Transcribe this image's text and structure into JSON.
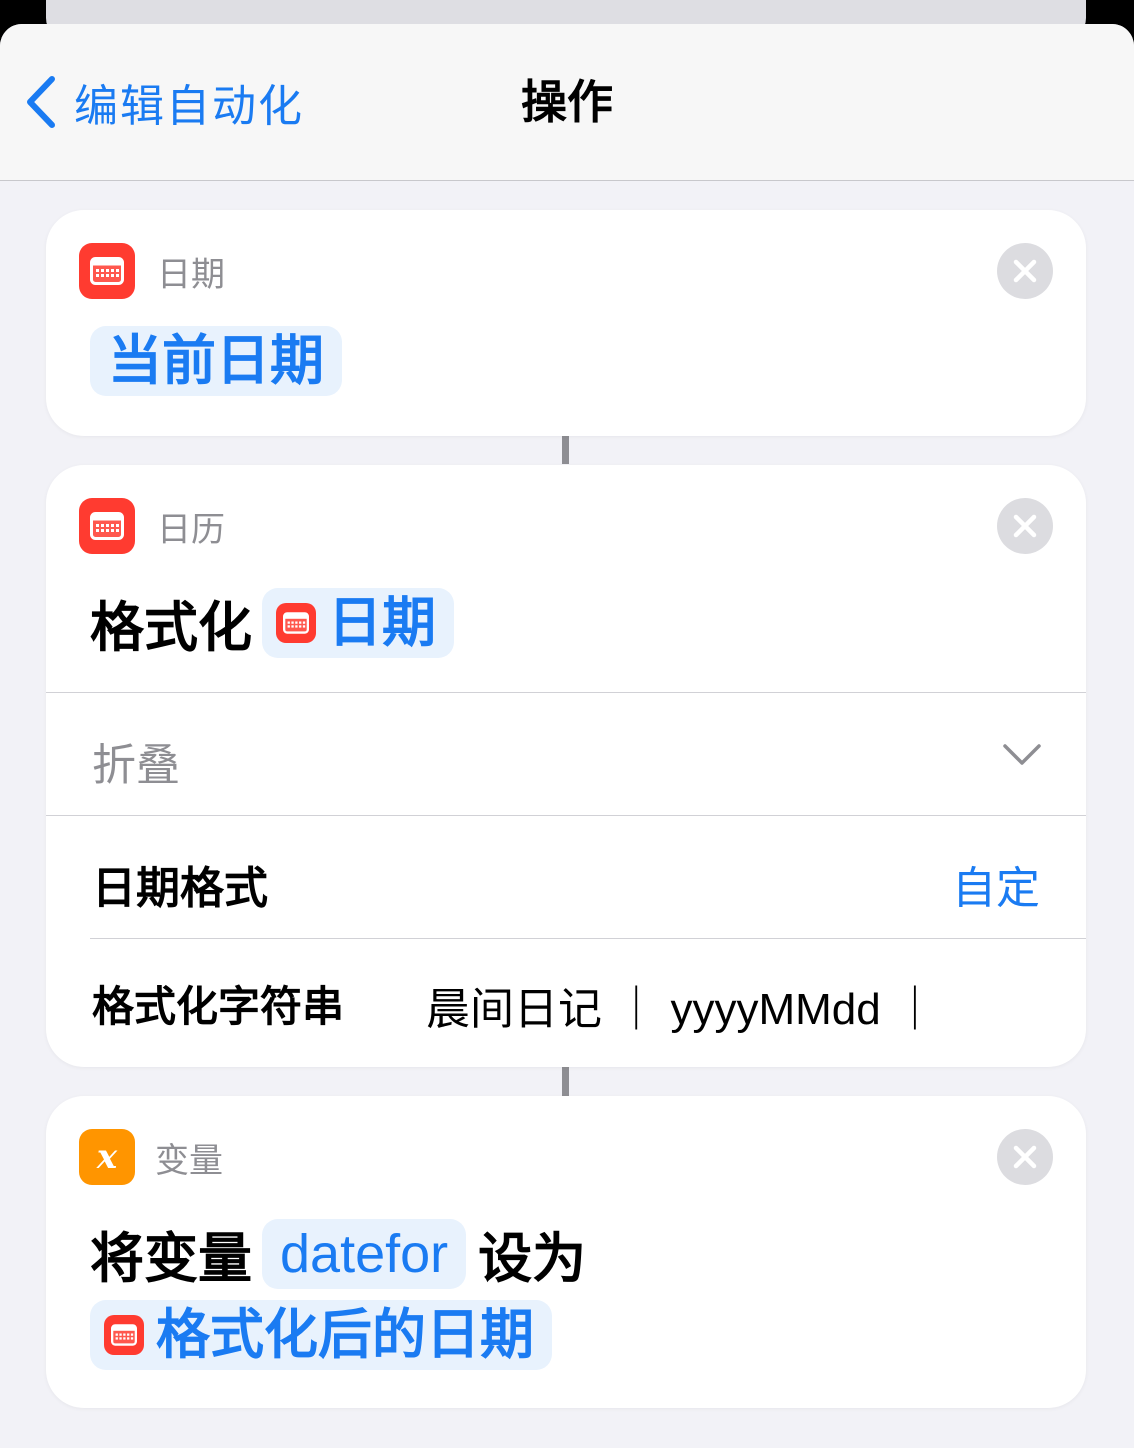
{
  "navbar": {
    "back_label": "编辑自动化",
    "title": "操作"
  },
  "cards": [
    {
      "app_label": "日期",
      "action_token": "当前日期"
    },
    {
      "app_label": "日历",
      "action_text": "格式化",
      "action_token": "日期",
      "collapse_label": "折叠",
      "date_format_label": "日期格式",
      "date_format_value": "自定",
      "format_string_label": "格式化字符串",
      "format_string_value": "晨间日记 ｜ yyyyMMdd ｜"
    },
    {
      "app_label": "变量",
      "action_prefix": "将变量",
      "variable_token": "datefor",
      "action_mid": "设为",
      "value_token": "格式化后的日期"
    }
  ],
  "colors": {
    "accent": "#1a7bf2",
    "calendar_icon": "#ff3b30",
    "variable_icon": "#ff9500"
  },
  "icons": [
    "chevron-left-icon",
    "calendar-icon",
    "close-icon",
    "chevron-down-icon",
    "variable-x-icon"
  ]
}
